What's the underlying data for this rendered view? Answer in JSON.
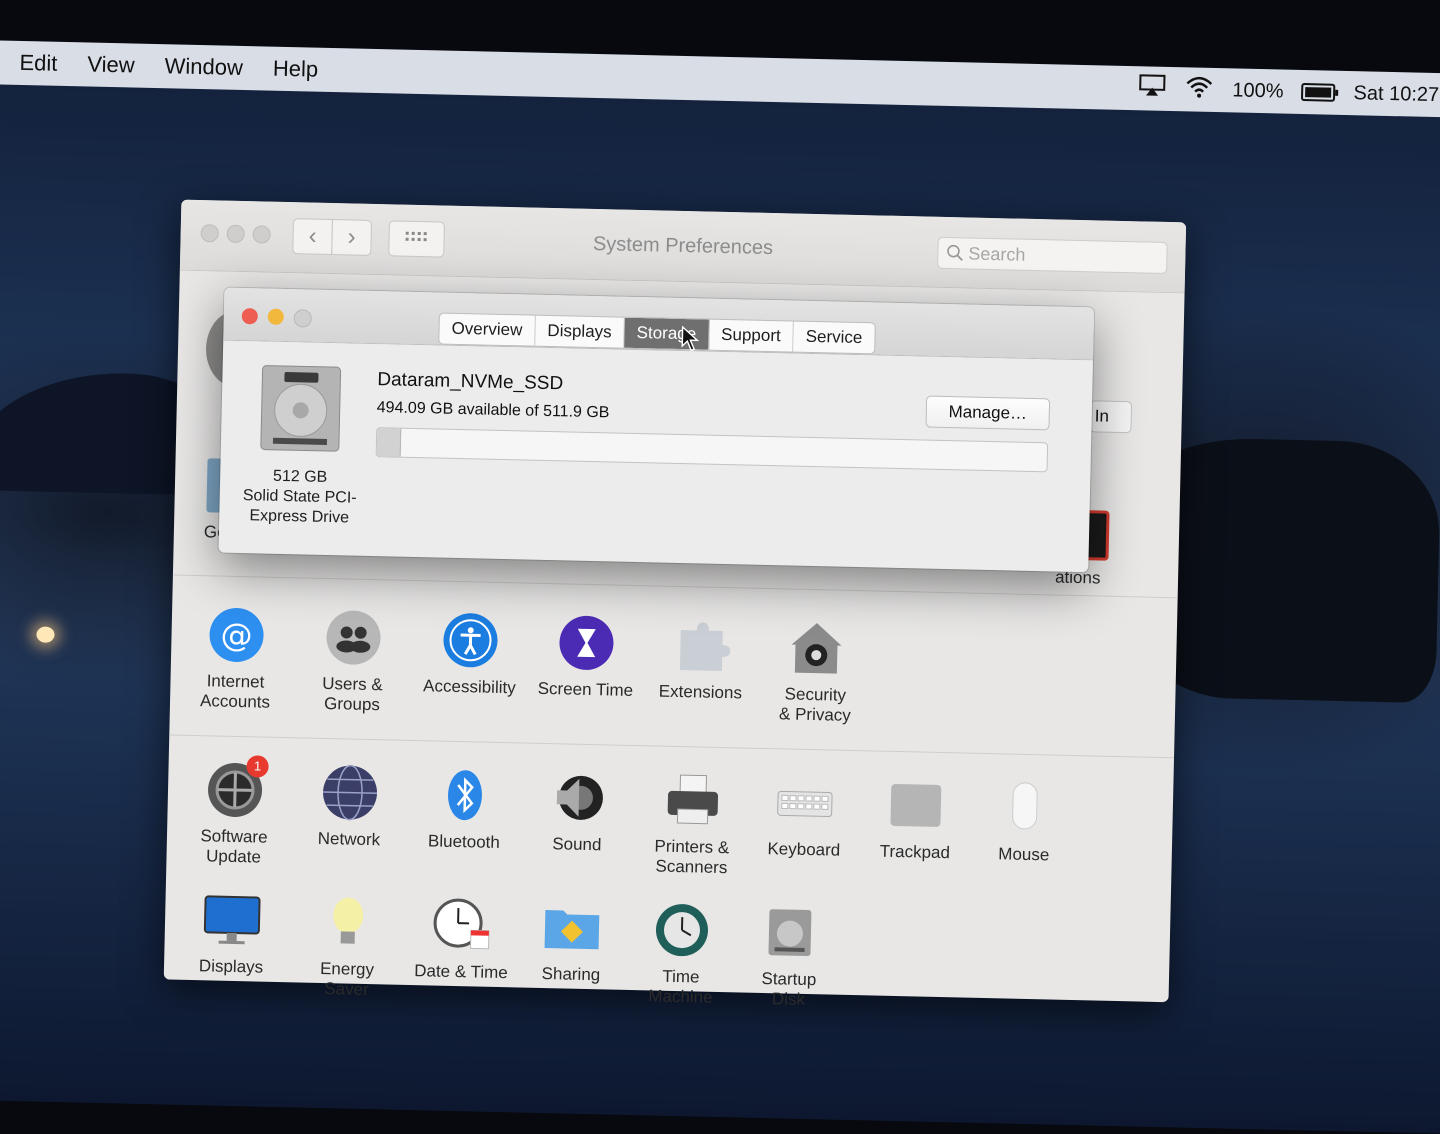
{
  "menubar": {
    "items": [
      "Edit",
      "View",
      "Window",
      "Help"
    ],
    "battery_percent": "100%",
    "clock": "Sat 10:27",
    "icons": [
      "airplay-icon",
      "wifi-icon",
      "battery-icon"
    ]
  },
  "prefs_window": {
    "title": "System Preferences",
    "search_placeholder": "Search",
    "partial_labels": {
      "left": "Ge",
      "right_top": "ations",
      "signin": "In"
    },
    "row2": [
      {
        "label": "Internet\nAccounts",
        "icon": "internet-accounts-icon"
      },
      {
        "label": "Users &\nGroups",
        "icon": "users-groups-icon"
      },
      {
        "label": "Accessibility",
        "icon": "accessibility-icon"
      },
      {
        "label": "Screen Time",
        "icon": "screen-time-icon"
      },
      {
        "label": "Extensions",
        "icon": "extensions-icon"
      },
      {
        "label": "Security\n& Privacy",
        "icon": "security-icon"
      }
    ],
    "row3": [
      {
        "label": "Software\nUpdate",
        "icon": "software-update-icon",
        "badge": "1"
      },
      {
        "label": "Network",
        "icon": "network-icon"
      },
      {
        "label": "Bluetooth",
        "icon": "bluetooth-icon"
      },
      {
        "label": "Sound",
        "icon": "sound-icon"
      },
      {
        "label": "Printers &\nScanners",
        "icon": "printer-icon"
      },
      {
        "label": "Keyboard",
        "icon": "keyboard-icon"
      },
      {
        "label": "Trackpad",
        "icon": "trackpad-icon"
      },
      {
        "label": "Mouse",
        "icon": "mouse-icon"
      }
    ],
    "row4": [
      {
        "label": "Displays",
        "icon": "displays-icon"
      },
      {
        "label": "Energy\nSaver",
        "icon": "energy-saver-icon"
      },
      {
        "label": "Date & Time",
        "icon": "date-time-icon"
      },
      {
        "label": "Sharing",
        "icon": "sharing-icon"
      },
      {
        "label": "Time\nMachine",
        "icon": "time-machine-icon"
      },
      {
        "label": "Startup\nDisk",
        "icon": "startup-disk-icon"
      }
    ]
  },
  "about_dialog": {
    "tabs": [
      "Overview",
      "Displays",
      "Storage",
      "Support",
      "Service"
    ],
    "active_tab": "Storage",
    "disk_size": "512 GB",
    "disk_type": "Solid State PCI-\nExpress Drive",
    "disk_name": "Dataram_NVMe_SSD",
    "available_text": "494.09 GB available of 511.9 GB",
    "used_fraction": 0.035,
    "manage_label": "Manage…",
    "colors": {
      "close": "#ee5d52",
      "minimize": "#f2b73d",
      "zoom": "#cfcfcf",
      "active_tab": "#6f6f6f"
    }
  }
}
